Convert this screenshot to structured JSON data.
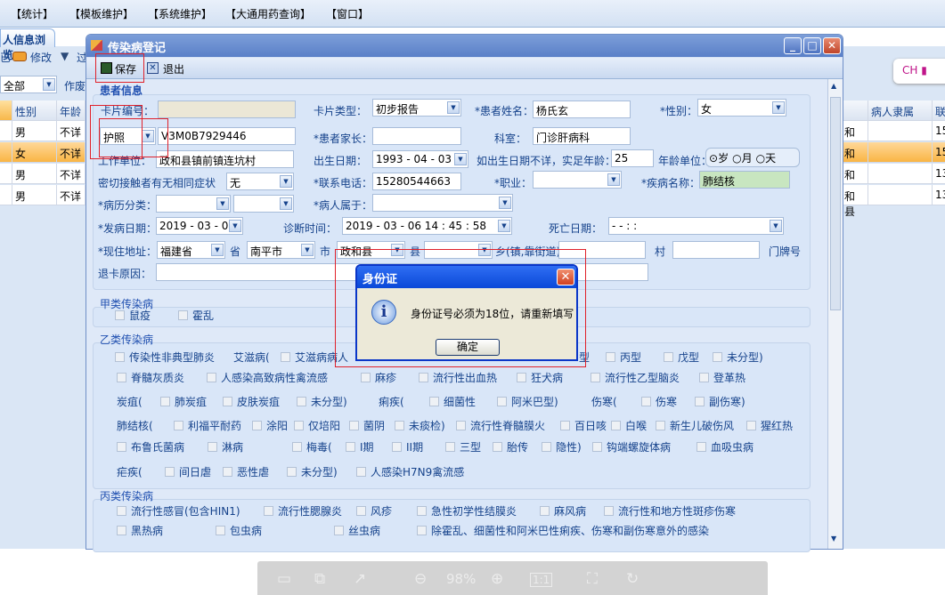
{
  "menu": [
    "【统计】",
    "【模板维护】",
    "【系统维护】",
    "【大通用药查询】",
    "【窗口】"
  ],
  "bg": {
    "tab": "人信息浏览",
    "tool_prefix": "已",
    "edit": "修改",
    "filter": "过",
    "filter_value": "全部",
    "void_label": "作废",
    "columns": [
      "性别",
      "年龄"
    ],
    "rows": [
      [
        "男",
        "不详"
      ],
      [
        "女",
        "不详"
      ],
      [
        "男",
        "不详"
      ],
      [
        "男",
        "不详"
      ]
    ],
    "right_columns": [
      "病人隶属",
      "联"
    ],
    "right_rows": [
      [
        "和县",
        "",
        "15"
      ],
      [
        "和县",
        "",
        "15"
      ],
      [
        "和县",
        "",
        "13"
      ],
      [
        "和县",
        "",
        "13"
      ]
    ],
    "ime": "CH"
  },
  "dialog": {
    "title": "传染病登记",
    "save": "保存",
    "exit": "退出"
  },
  "form": {
    "group": "患者信息",
    "card_no_label": "卡片编号：",
    "card_no": "",
    "card_type_label": "卡片类型：",
    "card_type": "初步报告",
    "name_label": "*患者姓名：",
    "name": "杨氏玄",
    "sex_label": "*性别：",
    "sex": "女",
    "id_type": "护照",
    "id_no": "V3M0B7929446",
    "parent_label": "*患者家长：",
    "parent": "",
    "dept_label": "科室：",
    "dept": "门诊肝病科",
    "work_label": "工作单位：",
    "work": "政和县镇前镇连坑村",
    "birth_label": "出生日期：",
    "birth": "1993 - 04 - 03",
    "age_label": "如出生日期不详，实足年龄：",
    "age": "25",
    "age_unit_label": "年龄单位：",
    "age_units": [
      "岁",
      "月",
      "天"
    ],
    "age_unit_selected": "岁",
    "contact_label": "密切接触者有无相同症状",
    "contact": "无",
    "phone_label": "*联系电话：",
    "phone": "15280544663",
    "job_label": "*职业：",
    "job": "",
    "disease_label": "*疾病名称：",
    "disease": "肺结核",
    "case_cat_label": "*病历分类：",
    "belong_label": "*病人属于：",
    "onset_label": "*发病日期：",
    "onset": "2019 - 03 - 06",
    "diag_label": "诊断时间：",
    "diag": "2019 - 03 - 06   14 : 45 : 58",
    "death_label": "死亡日期：",
    "death": "  -   -          :   :",
    "addr_label": "*现住地址：",
    "province": "福建省",
    "province_unit": "省",
    "city": "南平市",
    "city_unit": "市",
    "county": "政和县",
    "county_unit": "县",
    "town_unit": "乡(镇,靠街道)",
    "village_unit": "村",
    "door_unit": "门牌号",
    "return_label": "退卡原因："
  },
  "diseases": {
    "class_a": "甲类传染病",
    "a_rows": [
      [
        {
          "t": "鼠疫",
          "cb": true
        },
        {
          "t": "霍乱",
          "cb": true
        }
      ]
    ],
    "class_b": "乙类传染病",
    "b_rows": [
      [
        {
          "t": "传染性非典型肺炎",
          "cb": true
        },
        {
          "t": "艾滋病(",
          "cb": false
        },
        {
          "t": "艾滋病病人",
          "cb": true
        },
        {
          "t": "型",
          "cb": false
        },
        {
          "t": "丙型",
          "cb": true
        },
        {
          "t": "戊型",
          "cb": true
        },
        {
          "t": "未分型)",
          "cb": true
        }
      ],
      [
        {
          "t": "脊髓灰质炎",
          "cb": true
        },
        {
          "t": "人感染高致病性禽流感",
          "cb": true
        },
        {
          "t": "麻疹",
          "cb": true
        },
        {
          "t": "流行性出血热",
          "cb": true
        },
        {
          "t": "狂犬病",
          "cb": true
        },
        {
          "t": "流行性乙型脑炎",
          "cb": true
        },
        {
          "t": "登革热",
          "cb": true
        }
      ],
      [
        {
          "t": "炭疽(",
          "cb": false
        },
        {
          "t": "肺炭疽",
          "cb": true
        },
        {
          "t": "皮肤炭疽",
          "cb": true
        },
        {
          "t": "未分型)",
          "cb": true
        },
        {
          "t": "痢疾(",
          "cb": false
        },
        {
          "t": "细菌性",
          "cb": true
        },
        {
          "t": "阿米巴型)",
          "cb": true
        },
        {
          "t": "伤寒(",
          "cb": false
        },
        {
          "t": "伤寒",
          "cb": true
        },
        {
          "t": "副伤寒)",
          "cb": true
        }
      ],
      [
        {
          "t": "肺结核(",
          "cb": false
        },
        {
          "t": "利福平耐药",
          "cb": true
        },
        {
          "t": "涂阳",
          "cb": true
        },
        {
          "t": "仅培阳",
          "cb": true
        },
        {
          "t": "菌阴",
          "cb": true
        },
        {
          "t": "未痰检)",
          "cb": true
        },
        {
          "t": "流行性脊髓膜火",
          "cb": true
        },
        {
          "t": "百日咳",
          "cb": true
        },
        {
          "t": "白喉",
          "cb": true
        },
        {
          "t": "新生儿破伤风",
          "cb": true
        },
        {
          "t": "猩红热",
          "cb": true
        }
      ],
      [
        {
          "t": "布鲁氏菌病",
          "cb": true
        },
        {
          "t": "淋病",
          "cb": true
        },
        {
          "t": "梅毒(",
          "cb": true
        },
        {
          "t": "I期",
          "cb": true
        },
        {
          "t": "II期",
          "cb": true
        },
        {
          "t": "三型",
          "cb": true
        },
        {
          "t": "胎传",
          "cb": true
        },
        {
          "t": "隐性)",
          "cb": true
        },
        {
          "t": "钩端螺旋体病",
          "cb": true
        },
        {
          "t": "血吸虫病",
          "cb": true
        }
      ],
      [
        {
          "t": "疟疾(",
          "cb": false
        },
        {
          "t": "间日虐",
          "cb": true
        },
        {
          "t": "恶性虐",
          "cb": true
        },
        {
          "t": "未分型)",
          "cb": true
        },
        {
          "t": "人感染H7N9禽流感",
          "cb": true
        }
      ]
    ],
    "class_c": "丙类传染病",
    "c_rows": [
      [
        {
          "t": "流行性感冒(包含HIN1)",
          "cb": true
        },
        {
          "t": "流行性腮腺炎",
          "cb": true
        },
        {
          "t": "风疹",
          "cb": true
        },
        {
          "t": "急性初学性结膜炎",
          "cb": true
        },
        {
          "t": "麻风病",
          "cb": true
        },
        {
          "t": "流行性和地方性斑疹伤寒",
          "cb": true
        }
      ],
      [
        {
          "t": "黑热病",
          "cb": true
        },
        {
          "t": "包虫病",
          "cb": true
        },
        {
          "t": "丝虫病",
          "cb": true
        },
        {
          "t": "除霍乱、细菌性和阿米巴性痢疾、伤寒和副伤寒意外的感染",
          "cb": true
        }
      ]
    ]
  },
  "alert": {
    "title": "身份证",
    "message": "身份证号必须为18位，请重新填写",
    "ok": "确定",
    "icon": "info-icon"
  },
  "viewer": {
    "zoom": "98%",
    "icons": [
      "save-icon",
      "copy-icon",
      "share-icon",
      "zoom-out-icon",
      "zoom-in-icon",
      "actual-size-icon",
      "fit-icon",
      "rotate-icon"
    ]
  },
  "colors": {
    "title_bar": "#5a80c8",
    "alert_title": "#0a48d8",
    "selected_row": "#f9b544",
    "highlight_box": "#e0212a",
    "disease_field": "#c8e6c0"
  }
}
